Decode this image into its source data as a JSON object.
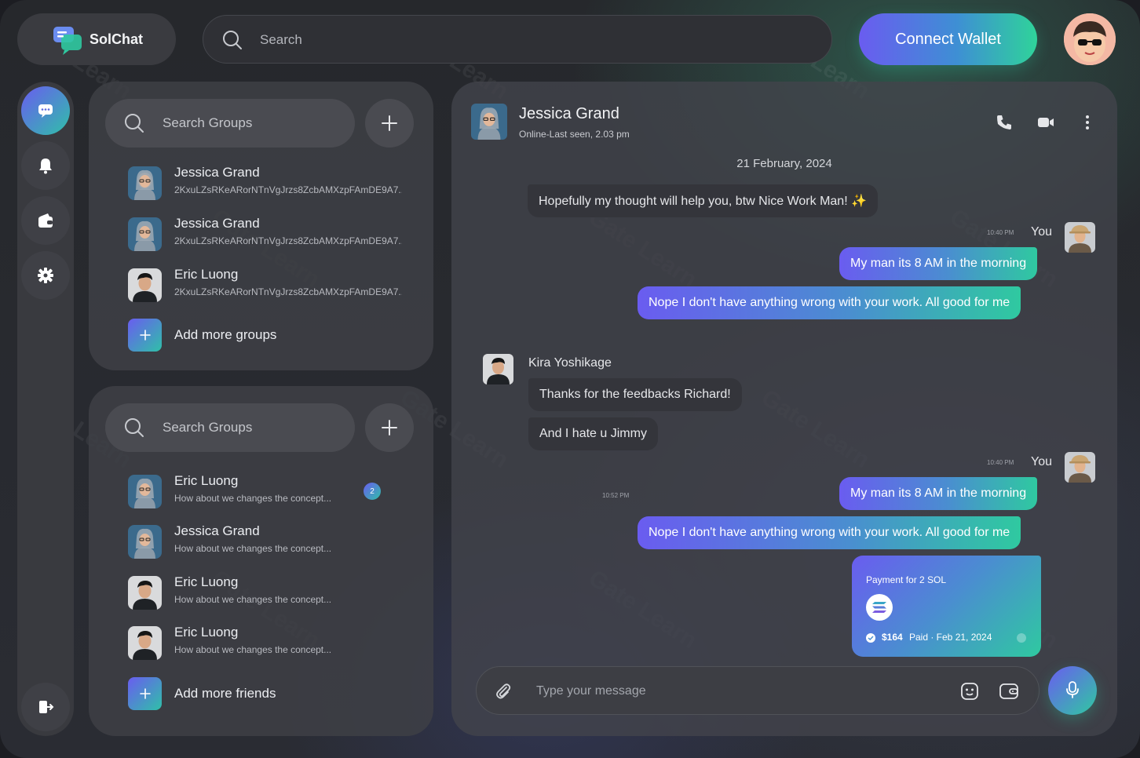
{
  "brand": {
    "name": "SolChat"
  },
  "search": {
    "placeholder": "Search"
  },
  "header": {
    "connect_label": "Connect Wallet"
  },
  "groups_panel": {
    "search_placeholder": "Search Groups",
    "items": [
      {
        "name": "Jessica Grand",
        "sub": "2KxuLZsRKeARorNTnVgJrzs8ZcbAMXzpFAmDE9A7..."
      },
      {
        "name": "Jessica Grand",
        "sub": "2KxuLZsRKeARorNTnVgJrzs8ZcbAMXzpFAmDE9A7..."
      },
      {
        "name": "Eric Luong",
        "sub": "2KxuLZsRKeARorNTnVgJrzs8ZcbAMXzpFAmDE9A7..."
      }
    ],
    "add_label": "Add more groups"
  },
  "friends_panel": {
    "search_placeholder": "Search Groups",
    "items": [
      {
        "name": "Eric Luong",
        "sub": "How about we changes the concept...",
        "badge": "2"
      },
      {
        "name": "Jessica Grand",
        "sub": "How about we changes the concept..."
      },
      {
        "name": "Eric Luong",
        "sub": "How about we changes the concept..."
      },
      {
        "name": "Eric Luong",
        "sub": "How about we changes the concept..."
      }
    ],
    "add_label": "Add more friends"
  },
  "chat": {
    "name": "Jessica Grand",
    "status": "Online-Last seen, 2.03 pm",
    "date": "21 February, 2024",
    "incoming_top": "Hopefully my thought will help you, btw Nice Work Man! ✨",
    "block1": {
      "time": "10:40 PM",
      "you": "You",
      "msg1": "My man its 8 AM in the morning",
      "msg2": "Nope I don't have anything wrong with your work. All good for me"
    },
    "kira": {
      "name": "Kira Yoshikage",
      "msg1": "Thanks for the feedbacks Richard!",
      "msg2": "And I hate u Jimmy",
      "time": "10:52 PM"
    },
    "block2": {
      "time": "10:40 PM",
      "you": "You",
      "msg1": "My man its 8 AM in the morning",
      "msg2": "Nope I don't have anything wrong with your work. All good for me"
    },
    "payment": {
      "title": "Payment for 2 SOL",
      "amount": "$164",
      "status": "Paid · Feb 21, 2024"
    },
    "composer_placeholder": "Type your message"
  },
  "watermark": "Gate Learn",
  "colors": {
    "accent_start": "#6a5cf0",
    "accent_end": "#2fc9a0"
  }
}
